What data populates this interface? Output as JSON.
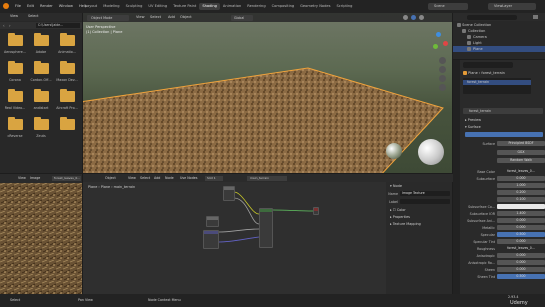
{
  "topbar": {
    "menus": [
      "File",
      "Edit",
      "Render",
      "Window",
      "Help"
    ],
    "workspaces": [
      "Layout",
      "Modeling",
      "Sculpting",
      "UV Editing",
      "Texture Paint",
      "Shading",
      "Animation",
      "Rendering",
      "Compositing",
      "Geometry Nodes",
      "Scripting"
    ],
    "active_workspace": "Shading",
    "scene": "Scene",
    "view_layer": "ViewLayer"
  },
  "file_browser": {
    "view_label": "View",
    "select_label": "Select",
    "path": "C:\\Users\\Jaide...",
    "folders": [
      "Aerosphere...",
      "Adobe",
      "Animatio...",
      "Corona",
      "Cordon-Off...",
      "Maxon Dev...",
      "Real Video...",
      "andistart",
      "Aircraft Pro...",
      "cReverse",
      "Zeuts",
      ""
    ]
  },
  "viewport": {
    "mode": "Object Mode",
    "menus": [
      "View",
      "Select",
      "Add",
      "Object"
    ],
    "shading": "Global",
    "overlay_line1": "User Perspective",
    "overlay_line2": "(1) Collection | Plane"
  },
  "outliner": {
    "title": "Scene Collection",
    "items": [
      {
        "label": "Collection",
        "indent": 1,
        "selected": false
      },
      {
        "label": "Camera",
        "indent": 2,
        "selected": false
      },
      {
        "label": "Light",
        "indent": 2,
        "selected": false
      },
      {
        "label": "Plane",
        "indent": 2,
        "selected": true
      }
    ]
  },
  "properties": {
    "object": "Plane",
    "material": "forest_terrain",
    "slot": "forest_terrain",
    "sections": [
      "Preview",
      "Surface"
    ],
    "surface_label": "Surface",
    "surface_value": "Principled BSDF",
    "distribution": "GGX",
    "subsurface_method": "Random Walk",
    "rows": [
      {
        "label": "Base Color",
        "value": "forest_leaves_0...",
        "style": "dark"
      },
      {
        "label": "Subsurface",
        "value": "0.000",
        "style": ""
      },
      {
        "label": "",
        "value": "1.000",
        "style": ""
      },
      {
        "label": "",
        "value": "0.200",
        "style": ""
      },
      {
        "label": "",
        "value": "0.100",
        "style": ""
      },
      {
        "label": "Subsurface Co...",
        "value": "",
        "style": "white"
      },
      {
        "label": "Subsurface IOR",
        "value": "1.400",
        "style": ""
      },
      {
        "label": "Subsurface Ani...",
        "value": "0.000",
        "style": ""
      },
      {
        "label": "Metallic",
        "value": "0.000",
        "style": ""
      },
      {
        "label": "Specular",
        "value": "0.500",
        "style": "blue"
      },
      {
        "label": "Specular Tint",
        "value": "0.000",
        "style": ""
      },
      {
        "label": "Roughness",
        "value": "forest_leaves_0...",
        "style": "dark"
      },
      {
        "label": "Anisotropic",
        "value": "0.000",
        "style": ""
      },
      {
        "label": "Anisotropic Ro...",
        "value": "0.000",
        "style": ""
      },
      {
        "label": "Sheen",
        "value": "0.000",
        "style": ""
      },
      {
        "label": "Sheen Tint",
        "value": "0.500",
        "style": "blue"
      }
    ]
  },
  "node_editor": {
    "editor_menus": [
      "Object",
      "View",
      "Select",
      "Add",
      "Node"
    ],
    "use_nodes": "Use Nodes",
    "slot": "Slot 1",
    "material": "main_terrain",
    "breadcrumb": [
      "Plane",
      "Plane",
      "main_terrain"
    ],
    "side_panel": {
      "header": "Node",
      "name_label": "Name",
      "name_value": "Image Texture",
      "label_label": "Label",
      "color_label": "Color",
      "properties_label": "Properties",
      "texture_mapping": "Texture Mapping"
    }
  },
  "image_editor": {
    "view_label": "View",
    "image_menu": "Image",
    "image_name": "forest_leaves_0..."
  },
  "statusbar": {
    "select": "Select",
    "pan": "Pan View",
    "context": "Node Context Menu",
    "version": "2.93.4"
  },
  "watermark": "Udemy"
}
